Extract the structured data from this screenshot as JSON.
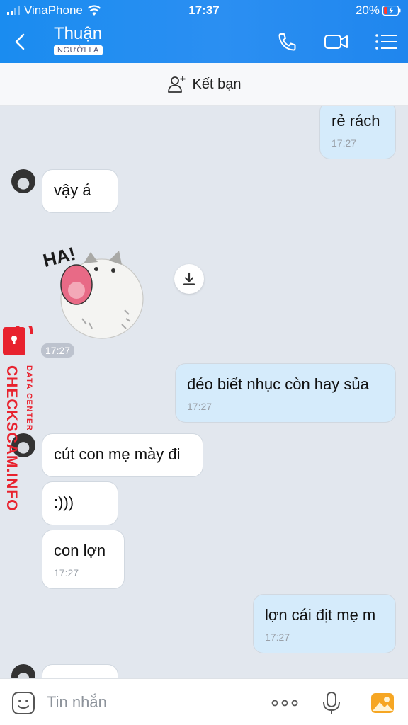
{
  "status_bar": {
    "carrier": "VinaPhone",
    "time": "17:37",
    "battery": "20%"
  },
  "header": {
    "contact_name": "Thuận",
    "badge": "NGƯỜI LẠ"
  },
  "add_friend": {
    "label": "Kết bạn"
  },
  "messages": [
    {
      "text": "rẻ rách",
      "time": "17:27"
    },
    {
      "text": "vậy á"
    },
    {
      "sticker_time": "17:27"
    },
    {
      "text": "đéo biết nhục còn hay sủa",
      "time": "17:27"
    },
    {
      "text": "cút con mẹ mày đi"
    },
    {
      "text": ":)))"
    },
    {
      "text": "con lợn",
      "time": "17:27"
    },
    {
      "text": "lợn cái địt mẹ m",
      "time": "17:27"
    }
  ],
  "sticker": {
    "text": "HA!"
  },
  "watermark": {
    "brand": "CHECKSCAM.INFO",
    "sub": "DATA CENTER"
  },
  "composer": {
    "placeholder": "Tin nhắn"
  },
  "colors": {
    "header": "#1a8cf0",
    "outgoing_bubble": "#d5ebfb",
    "incoming_bubble": "#ffffff",
    "background": "#e2e7ee"
  }
}
